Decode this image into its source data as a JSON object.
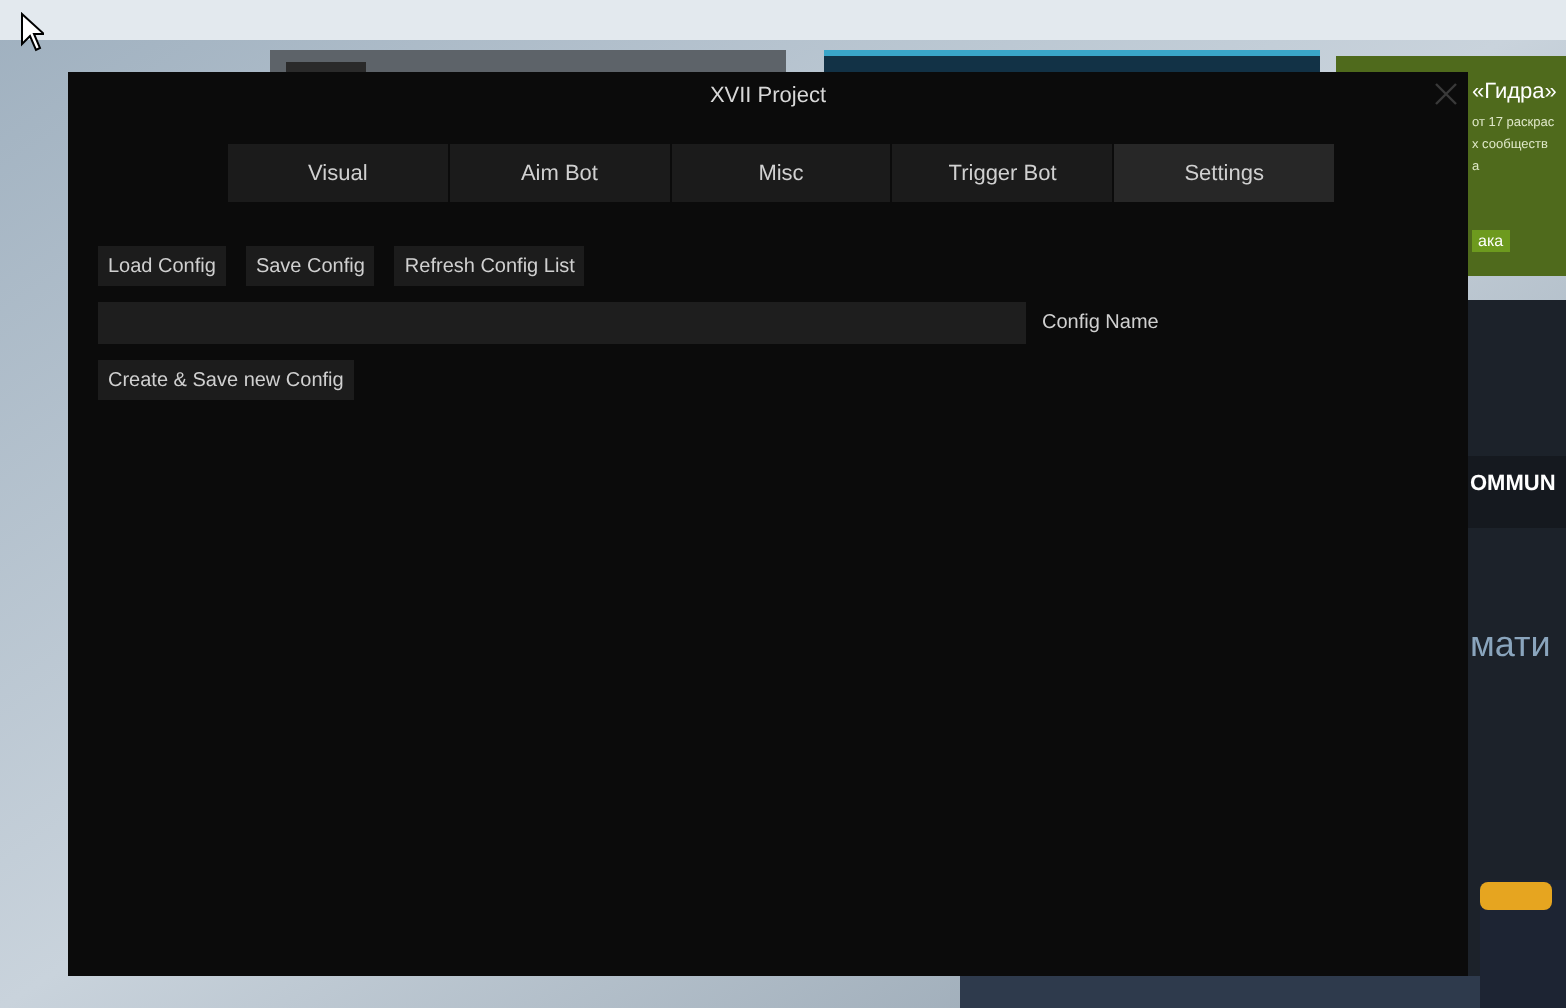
{
  "background": {
    "promo_title": "«Гидра»",
    "promo_lines": [
      "от 17 раскрас",
      "х сообществ",
      "а"
    ],
    "promo_button": "ака",
    "banner": "OMMUN",
    "headline": "мати"
  },
  "window": {
    "title": "XVII Project"
  },
  "tabs": [
    {
      "label": "Visual",
      "selected": false
    },
    {
      "label": "Aim Bot",
      "selected": false
    },
    {
      "label": "Misc",
      "selected": false
    },
    {
      "label": "Trigger Bot",
      "selected": false
    },
    {
      "label": "Settings",
      "selected": true
    }
  ],
  "config_buttons": [
    "Load Config",
    "Save Config",
    "Refresh Config List"
  ],
  "config_name": {
    "label": "Config Name"
  },
  "create_button": "Create & Save new Config"
}
